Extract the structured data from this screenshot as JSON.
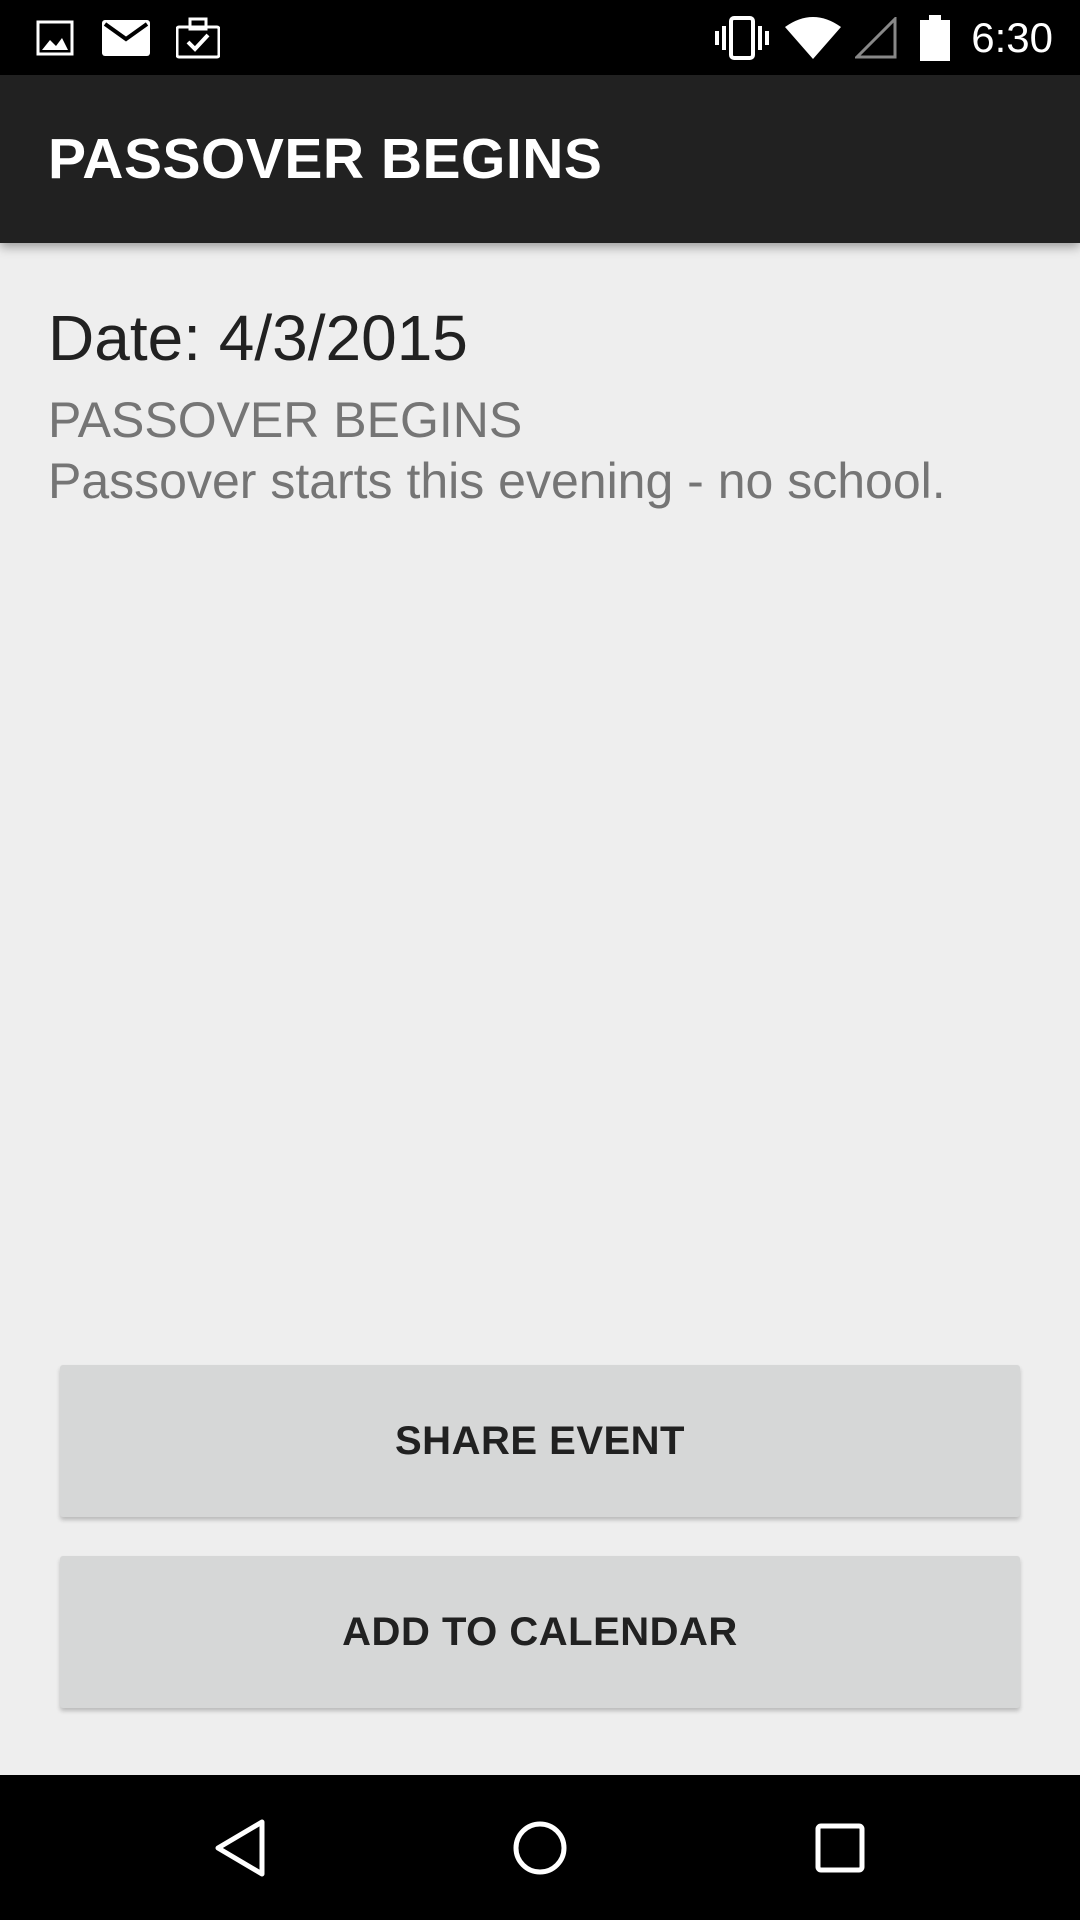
{
  "status_bar": {
    "time": "6:30",
    "left_icons": [
      "image-icon",
      "mail-icon",
      "work-briefcase-icon"
    ],
    "right_icons": [
      "vibrate-icon",
      "wifi-icon",
      "cell-signal-icon",
      "battery-icon"
    ]
  },
  "app_bar": {
    "title": "PASSOVER BEGINS"
  },
  "event": {
    "date": "Date: 4/3/2015",
    "title": "PASSOVER BEGINS",
    "description": "Passover starts this evening - no school."
  },
  "actions": {
    "share_label": "SHARE EVENT",
    "calendar_label": "ADD TO CALENDAR"
  },
  "nav_bar": {
    "icons": [
      "back-icon",
      "home-icon",
      "recents-icon"
    ]
  },
  "colors": {
    "status_bar": "#000000",
    "app_bar": "#212121",
    "background": "#eeeeee",
    "button": "#d6d7d7",
    "primary_text": "#212121",
    "secondary_text": "#757575"
  }
}
